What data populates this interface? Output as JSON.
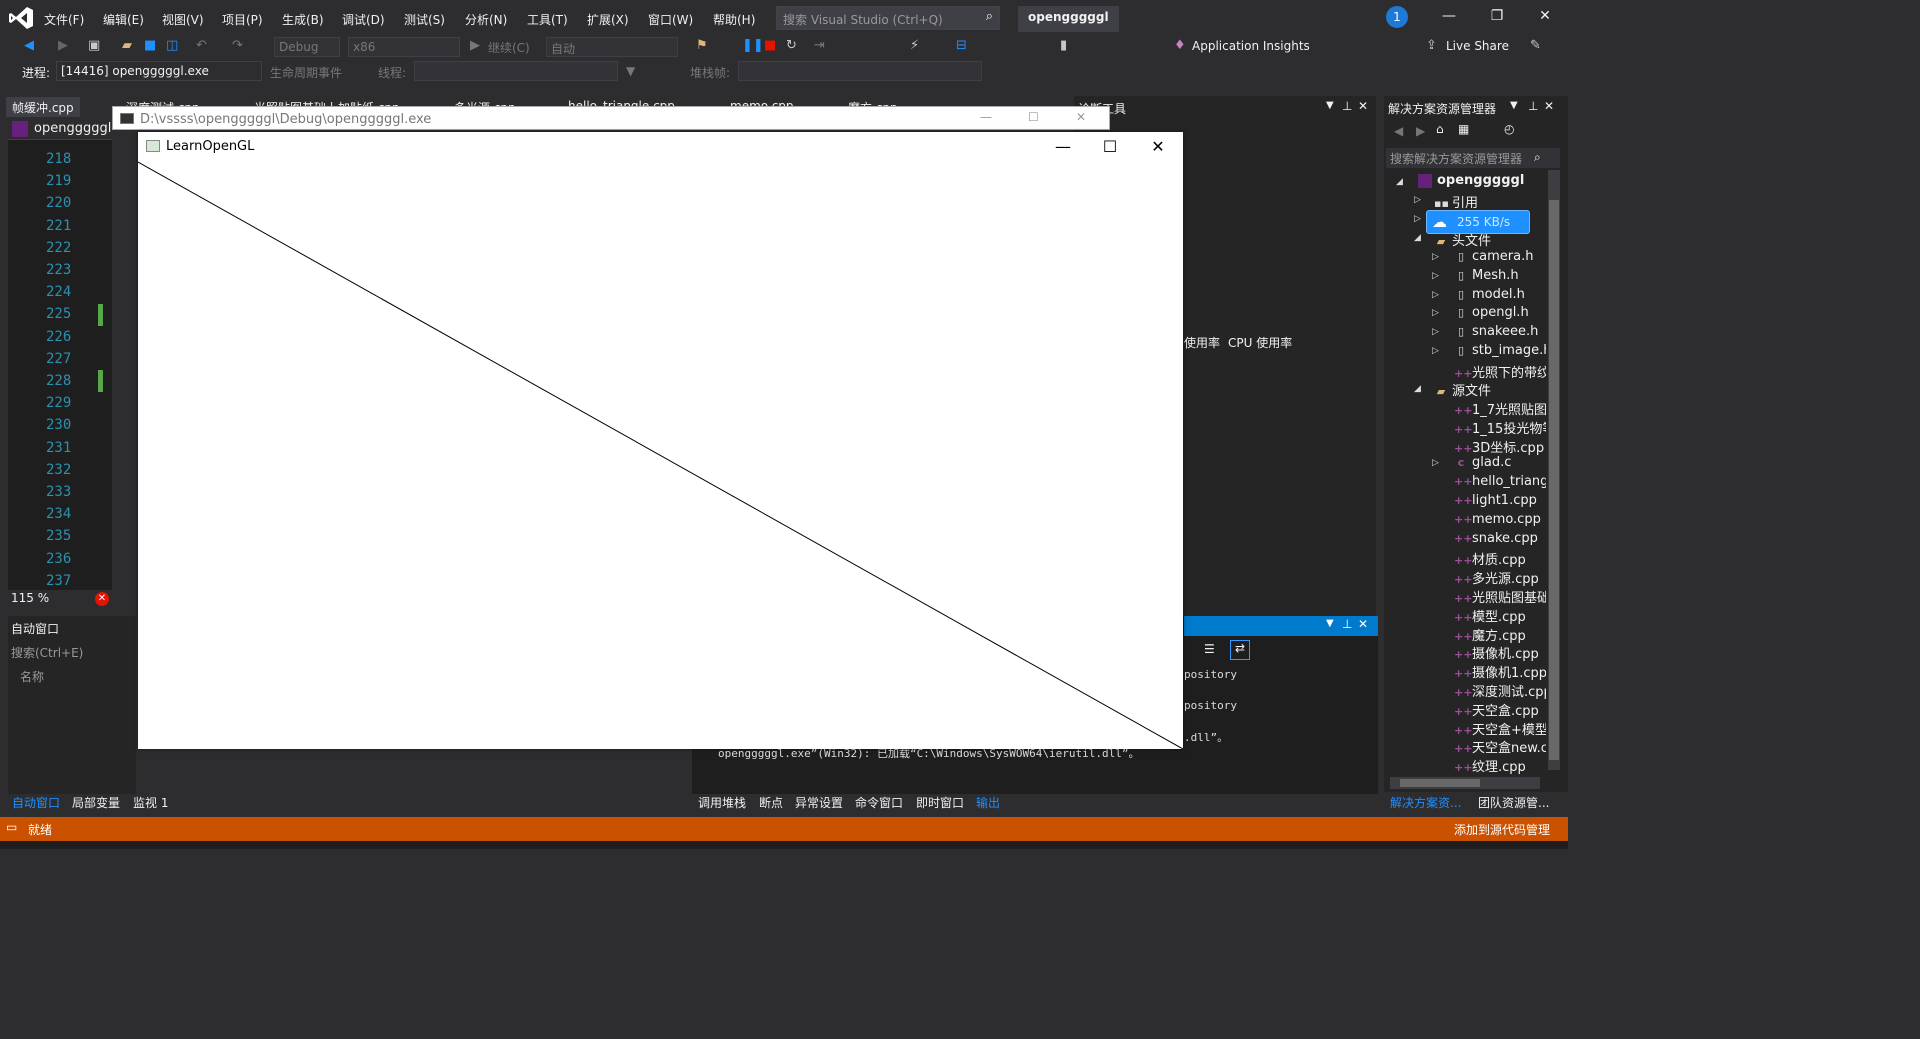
{
  "menu": {
    "items": [
      "文件(F)",
      "编辑(E)",
      "视图(V)",
      "项目(P)",
      "生成(B)",
      "调试(D)",
      "测试(S)",
      "分析(N)",
      "工具(T)",
      "扩展(X)",
      "窗口(W)",
      "帮助(H)"
    ],
    "search_placeholder": "搜索 Visual Studio (Ctrl+Q)",
    "project_title": "opengggggl",
    "notification_count": "1"
  },
  "toolbar": {
    "config": "Debug",
    "platform": "x86",
    "continue": "继续(C)",
    "auto": "自动",
    "app_insights": "Application Insights",
    "live_share": "Live Share"
  },
  "toolbar2": {
    "process_label": "进程:",
    "process_value": "[14416] opengggggl.exe",
    "lifecycle": "生命周期事件",
    "thread_label": "线程:",
    "stack_label": "堆栈帧:"
  },
  "tabs": [
    "帧缓冲.cpp",
    "深度测试.cpp",
    "光照贴图基础上加贴纸.cpp",
    "多光源.cpp",
    "hello_triangle.cpp",
    "memo.cpp",
    "魔方.cpp"
  ],
  "editor": {
    "dropdown": "opengggggl",
    "line_numbers": [
      "218",
      "219",
      "220",
      "221",
      "222",
      "223",
      "224",
      "225",
      "226",
      "227",
      "228",
      "229",
      "230",
      "231",
      "232",
      "233",
      "234",
      "235",
      "236",
      "237"
    ],
    "zoom": "115 %"
  },
  "auto_window": {
    "title": "自动窗口",
    "search": "搜索(Ctrl+E)",
    "column_name": "名称"
  },
  "bottom_tabs_left": [
    "自动窗口",
    "局部变量",
    "监视 1"
  ],
  "bottom_tabs_middle": [
    "调用堆栈",
    "断点",
    "异常设置",
    "命令窗口",
    "即时窗口",
    "输出"
  ],
  "diagnostics": {
    "title": "诊断工具",
    "memory": "使用率",
    "cpu": "CPU 使用率"
  },
  "output": {
    "lines": [
      "pository",
      "pository",
      ".dll”。"
    ],
    "footer_line": "opengggggl.exe”(Win32): 已加载“C:\\Windows\\SysWOW64\\ierutil.dll”。"
  },
  "solution_explorer": {
    "title": "解决方案资源管理器",
    "search": "搜索解决方案资源管理器",
    "project": "opengggggl",
    "references": "引用",
    "header_folder": "头文件",
    "headers": [
      "camera.h",
      "Mesh.h",
      "model.h",
      "opengl.h",
      "snakeee.h",
      "stb_image.h",
      "光照下的带纹"
    ],
    "source_folder": "源文件",
    "sources": [
      "1_7光照贴图",
      "1_15投光物等",
      "3D坐标.cpp",
      "glad.c",
      "hello_triang",
      "light1.cpp",
      "memo.cpp",
      "snake.cpp",
      "材质.cpp",
      "多光源.cpp",
      "光照贴图基础",
      "模型.cpp",
      "魔方.cpp",
      "摄像机.cpp",
      "摄像机1.cpp",
      "深度测试.cpp",
      "天空盒.cpp",
      "天空盒+模型",
      "天空盒new.c",
      "纹理.cpp"
    ],
    "net_speed": "255 KB/s",
    "tabs": [
      "解决方案资...",
      "团队资源管..."
    ]
  },
  "console_window": {
    "title": "D:\\vssss\\opengggggl\\Debug\\opengggggl.exe"
  },
  "gl_window": {
    "title": "LearnOpenGL"
  },
  "status": {
    "left": "就绪",
    "right": "添加到源代码管理"
  }
}
